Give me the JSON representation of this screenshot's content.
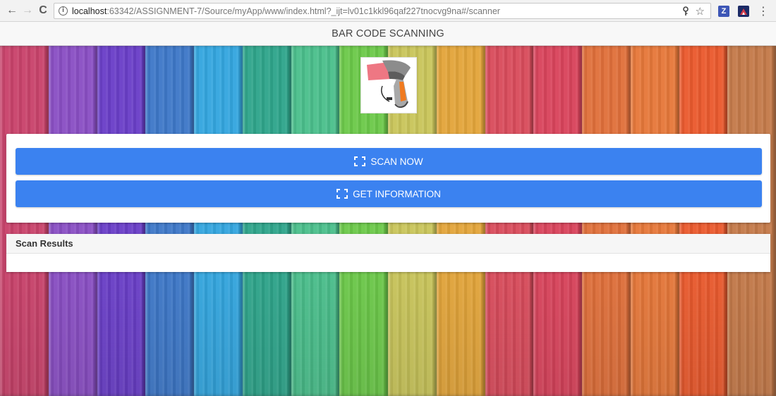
{
  "browser": {
    "url_host": "localhost",
    "url_rest": ":63342/ASSIGNMENT-7/Source/myApp/www/index.html?_ijt=lv01c1kkl96qaf227tnocvg9na#/scanner",
    "back_glyph": "←",
    "forward_glyph": "→",
    "reload_glyph": "C",
    "info_glyph": "i",
    "menu_glyph": "⋮",
    "star_glyph": "☆",
    "ext_z_label": "Z"
  },
  "header": {
    "title": "BAR CODE SCANNING"
  },
  "actions": {
    "scan_label": "SCAN NOW",
    "info_label": "GET INFORMATION"
  },
  "results": {
    "title": "Scan Results"
  },
  "colors": {
    "button": "#3b82f0",
    "planks": [
      "#c9436b",
      "#8a4fc4",
      "#6a3fc8",
      "#3e78c8",
      "#34a6df",
      "#2fa58b",
      "#4bbf8c",
      "#6cc94a",
      "#c9c55b",
      "#e3a53b",
      "#d94c5c",
      "#d9445c",
      "#e0703b",
      "#e6783a",
      "#ea5a2e",
      "#c47a4a"
    ]
  }
}
